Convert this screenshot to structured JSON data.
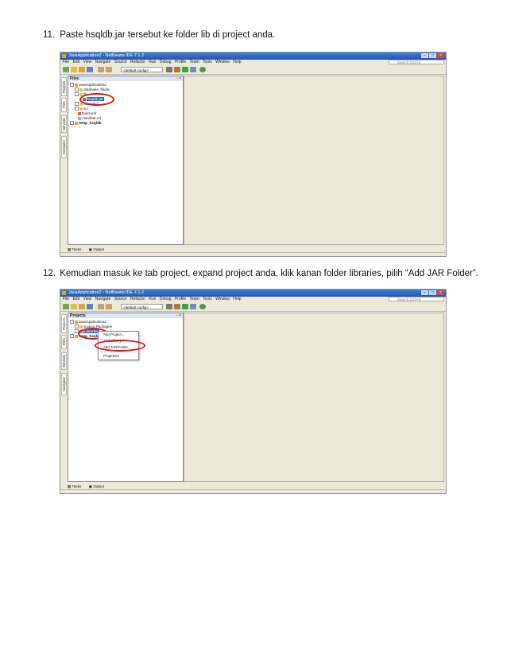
{
  "steps": [
    {
      "number": "11.",
      "text": "Paste hsqldb.jar tersebut ke folder lib di project anda.",
      "screenshot": {
        "window_title": "JavaApplication2 - NetBeans IDE 7.1.2",
        "menu": [
          "File",
          "Edit",
          "View",
          "Navigate",
          "Source",
          "Refactor",
          "Run",
          "Debug",
          "Profile",
          "Team",
          "Tools",
          "Window",
          "Help"
        ],
        "search_placeholder": "Search (Ctrl+I)",
        "config": "<default config>",
        "side_tabs": [
          "Projects",
          "Files",
          "Services",
          "Navigator"
        ],
        "panel_title": "Files",
        "tree": [
          "JavaApplication2",
          "database_folder",
          "lib",
          "hsqldb.jar",
          "nbproject",
          "src",
          "build.xml",
          "manifest.mf",
          "temp_hsqldb"
        ],
        "bottom_tabs": [
          "Tasks",
          "Output"
        ]
      }
    },
    {
      "number": "12.",
      "text": "Kemudian masuk ke tab project, expand project anda, klik kanan folder libraries, pilih “Add JAR Folder”.",
      "screenshot": {
        "window_title": "JavaApplication2 - NetBeans IDE 7.1.2",
        "menu": [
          "File",
          "Edit",
          "View",
          "Navigate",
          "Source",
          "Refactor",
          "Run",
          "Debug",
          "Profile",
          "Team",
          "Tools",
          "Window",
          "Help"
        ],
        "search_placeholder": "Search (Ctrl+I)",
        "config": "<default config>",
        "side_tabs": [
          "Projects",
          "Files",
          "Services",
          "Navigator"
        ],
        "panel_title": "Projects",
        "tree": [
          "JavaApplication2",
          "Source Packages",
          "Libraries",
          "temp_hsqldb"
        ],
        "context_menu": [
          "Add Project...",
          "Add Library...",
          "Add JAR/Folder...",
          "Properties"
        ],
        "bottom_tabs": [
          "Tasks",
          "Output"
        ]
      }
    }
  ],
  "colors": {
    "titlebar": "#1f56b6",
    "highlight": "#e01010",
    "selection": "#3163c4"
  }
}
